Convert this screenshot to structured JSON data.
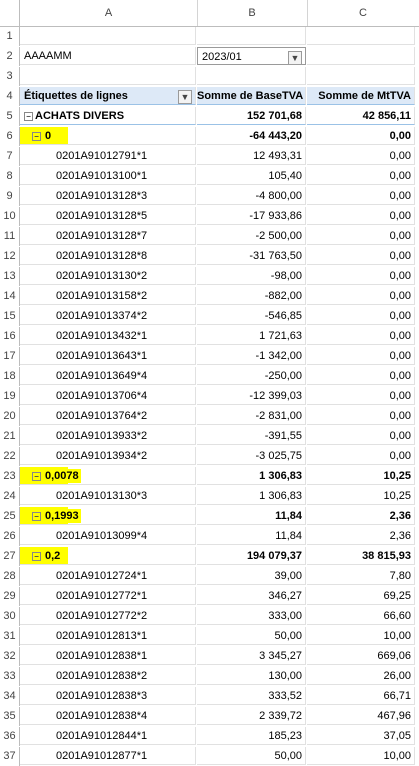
{
  "columns": [
    "A",
    "B",
    "C"
  ],
  "filter": {
    "label": "AAAAMM",
    "value": "2023/01"
  },
  "header": {
    "row_labels": "Étiquettes de lignes",
    "base_tva": "Somme de BaseTVA",
    "mt_tva": "Somme de MtTVA"
  },
  "rows": [
    {
      "n": "1",
      "a": "",
      "b": "",
      "c": ""
    },
    {
      "n": "2",
      "a": "AAAAMM",
      "b": "2023/01",
      "c": ""
    },
    {
      "n": "3",
      "a": "",
      "b": "",
      "c": ""
    },
    {
      "n": "4",
      "a": "Étiquettes de lignes",
      "b": "Somme de BaseTVA",
      "c": "Somme de MtTVA"
    },
    {
      "n": "5",
      "a": "ACHATS DIVERS",
      "b": "152 701,68",
      "c": "42 856,11"
    },
    {
      "n": "6",
      "a": "0",
      "b": "-64 443,20",
      "c": "0,00"
    },
    {
      "n": "7",
      "a": "0201A91012791*1",
      "b": "12 493,31",
      "c": "0,00"
    },
    {
      "n": "8",
      "a": "0201A91013100*1",
      "b": "105,40",
      "c": "0,00"
    },
    {
      "n": "9",
      "a": "0201A91013128*3",
      "b": "-4 800,00",
      "c": "0,00"
    },
    {
      "n": "10",
      "a": "0201A91013128*5",
      "b": "-17 933,86",
      "c": "0,00"
    },
    {
      "n": "11",
      "a": "0201A91013128*7",
      "b": "-2 500,00",
      "c": "0,00"
    },
    {
      "n": "12",
      "a": "0201A91013128*8",
      "b": "-31 763,50",
      "c": "0,00"
    },
    {
      "n": "13",
      "a": "0201A91013130*2",
      "b": "-98,00",
      "c": "0,00"
    },
    {
      "n": "14",
      "a": "0201A91013158*2",
      "b": "-882,00",
      "c": "0,00"
    },
    {
      "n": "15",
      "a": "0201A91013374*2",
      "b": "-546,85",
      "c": "0,00"
    },
    {
      "n": "16",
      "a": "0201A91013432*1",
      "b": "1 721,63",
      "c": "0,00"
    },
    {
      "n": "17",
      "a": "0201A91013643*1",
      "b": "-1 342,00",
      "c": "0,00"
    },
    {
      "n": "18",
      "a": "0201A91013649*4",
      "b": "-250,00",
      "c": "0,00"
    },
    {
      "n": "19",
      "a": "0201A91013706*4",
      "b": "-12 399,03",
      "c": "0,00"
    },
    {
      "n": "20",
      "a": "0201A91013764*2",
      "b": "-2 831,00",
      "c": "0,00"
    },
    {
      "n": "21",
      "a": "0201A91013933*2",
      "b": "-391,55",
      "c": "0,00"
    },
    {
      "n": "22",
      "a": "0201A91013934*2",
      "b": "-3 025,75",
      "c": "0,00"
    },
    {
      "n": "23",
      "a": "0,0078",
      "b": "1 306,83",
      "c": "10,25"
    },
    {
      "n": "24",
      "a": "0201A91013130*3",
      "b": "1 306,83",
      "c": "10,25"
    },
    {
      "n": "25",
      "a": "0,1993",
      "b": "11,84",
      "c": "2,36"
    },
    {
      "n": "26",
      "a": "0201A91013099*4",
      "b": "11,84",
      "c": "2,36"
    },
    {
      "n": "27",
      "a": "0,2",
      "b": "194 079,37",
      "c": "38 815,93"
    },
    {
      "n": "28",
      "a": "0201A91012724*1",
      "b": "39,00",
      "c": "7,80"
    },
    {
      "n": "29",
      "a": "0201A91012772*1",
      "b": "346,27",
      "c": "69,25"
    },
    {
      "n": "30",
      "a": "0201A91012772*2",
      "b": "333,00",
      "c": "66,60"
    },
    {
      "n": "31",
      "a": "0201A91012813*1",
      "b": "50,00",
      "c": "10,00"
    },
    {
      "n": "32",
      "a": "0201A91012838*1",
      "b": "3 345,27",
      "c": "669,06"
    },
    {
      "n": "33",
      "a": "0201A91012838*2",
      "b": "130,00",
      "c": "26,00"
    },
    {
      "n": "34",
      "a": "0201A91012838*3",
      "b": "333,52",
      "c": "66,71"
    },
    {
      "n": "35",
      "a": "0201A91012838*4",
      "b": "2 339,72",
      "c": "467,96"
    },
    {
      "n": "36",
      "a": "0201A91012844*1",
      "b": "185,23",
      "c": "37,05"
    },
    {
      "n": "37",
      "a": "0201A91012877*1",
      "b": "50,00",
      "c": "10,00"
    }
  ]
}
